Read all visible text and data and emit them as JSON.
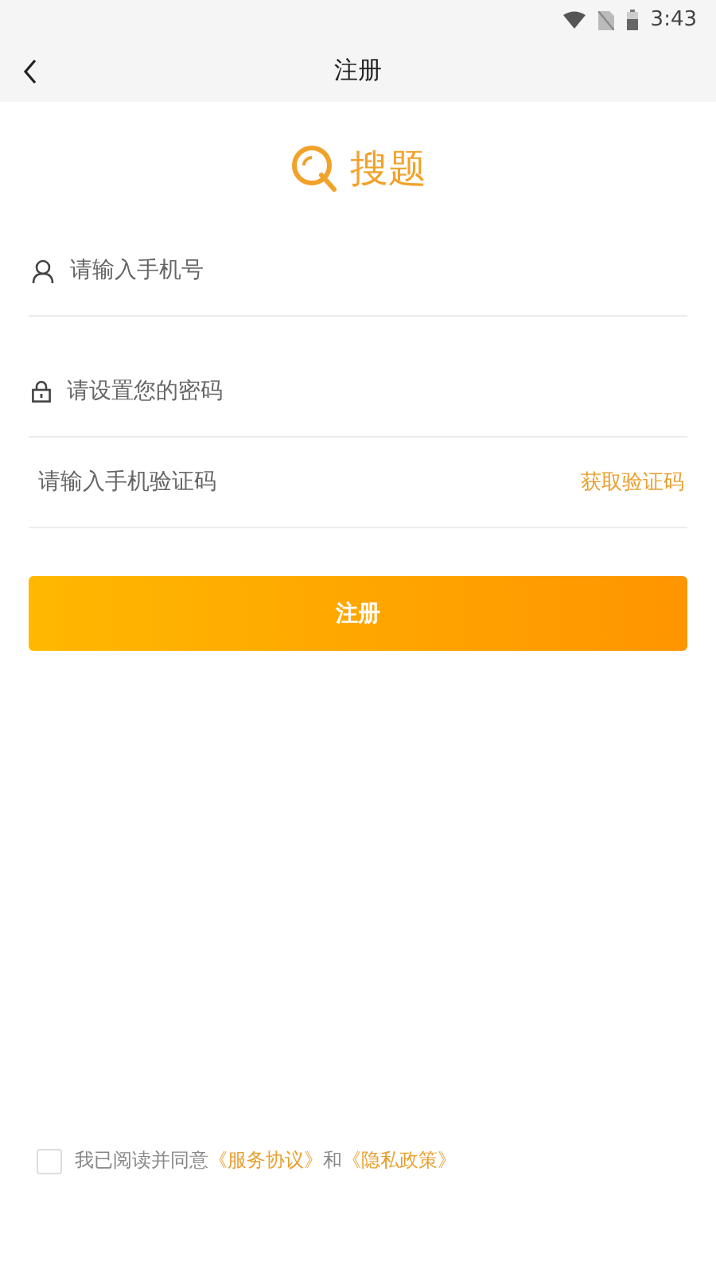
{
  "status_bar": {
    "time": "3:43"
  },
  "nav": {
    "title": "注册"
  },
  "logo": {
    "text": "搜题"
  },
  "fields": [
    {
      "kind": "phone",
      "placeholder": "请输入手机号"
    },
    {
      "kind": "password",
      "placeholder": "请设置您的密码"
    },
    {
      "kind": "code",
      "placeholder": "请输入手机验证码",
      "action": "获取验证码"
    }
  ],
  "submit": "注册",
  "agreement": {
    "checked": false,
    "parts": [
      {
        "kind": "text",
        "text": "我已阅读并同意"
      },
      {
        "kind": "link",
        "text": "《服务协议》"
      },
      {
        "kind": "text",
        "text": "和"
      },
      {
        "kind": "link",
        "text": "《隐私政策》"
      }
    ]
  }
}
